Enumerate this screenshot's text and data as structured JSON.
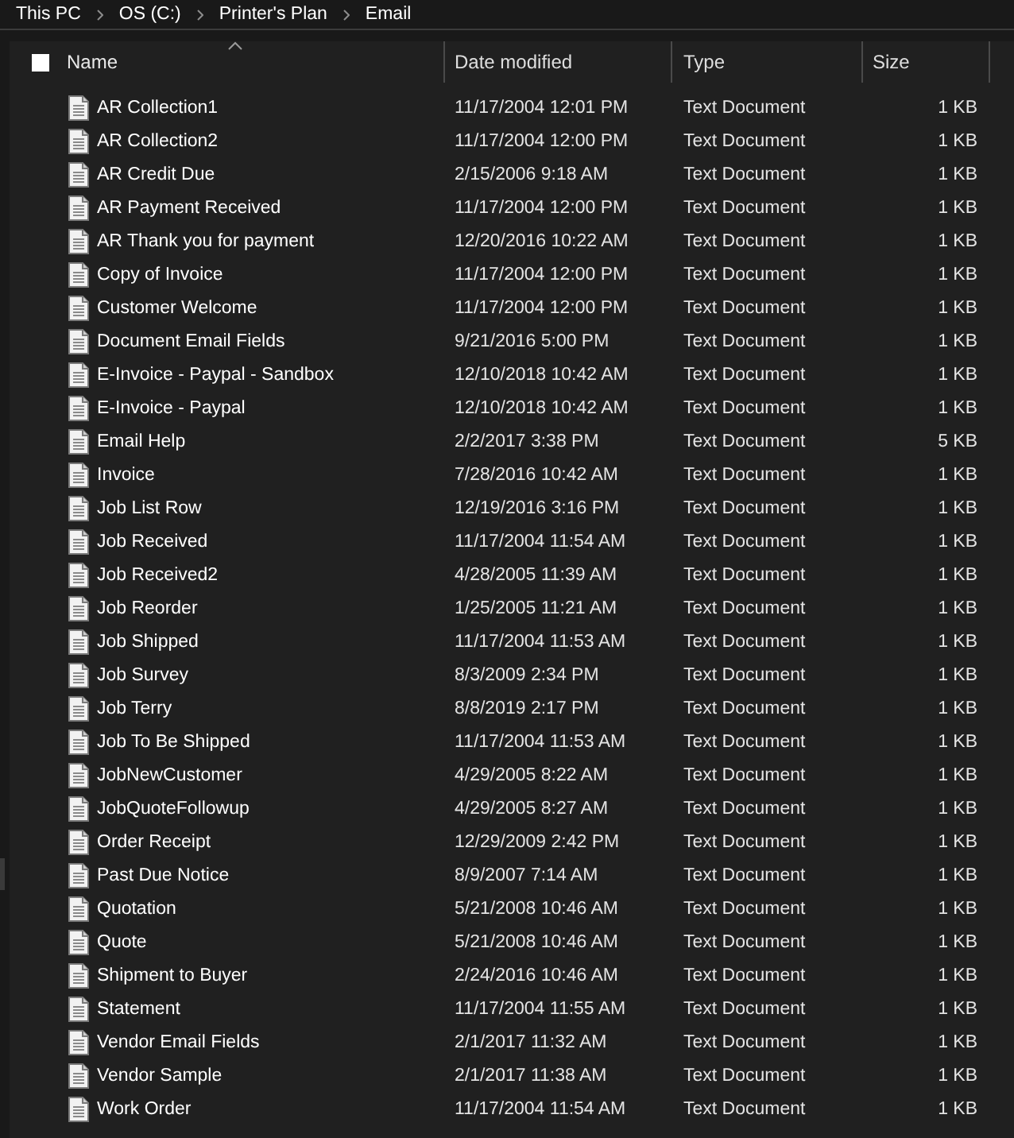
{
  "breadcrumb": [
    "This PC",
    "OS (C:)",
    "Printer's Plan",
    "Email"
  ],
  "select_all": {
    "checked": false
  },
  "columns": [
    {
      "label": "Name",
      "sorted": true
    },
    {
      "label": "Date modified",
      "sorted": false
    },
    {
      "label": "Type",
      "sorted": false
    },
    {
      "label": "Size",
      "sorted": false
    }
  ],
  "files": [
    {
      "name": "AR Collection1",
      "date_modified": "11/17/2004 12:01 PM",
      "type": "Text Document",
      "size": "1 KB"
    },
    {
      "name": "AR Collection2",
      "date_modified": "11/17/2004 12:00 PM",
      "type": "Text Document",
      "size": "1 KB"
    },
    {
      "name": "AR Credit Due",
      "date_modified": "2/15/2006 9:18 AM",
      "type": "Text Document",
      "size": "1 KB"
    },
    {
      "name": "AR Payment Received",
      "date_modified": "11/17/2004 12:00 PM",
      "type": "Text Document",
      "size": "1 KB"
    },
    {
      "name": "AR Thank you for payment",
      "date_modified": "12/20/2016 10:22 AM",
      "type": "Text Document",
      "size": "1 KB"
    },
    {
      "name": "Copy of Invoice",
      "date_modified": "11/17/2004 12:00 PM",
      "type": "Text Document",
      "size": "1 KB"
    },
    {
      "name": "Customer Welcome",
      "date_modified": "11/17/2004 12:00 PM",
      "type": "Text Document",
      "size": "1 KB"
    },
    {
      "name": "Document Email Fields",
      "date_modified": "9/21/2016 5:00 PM",
      "type": "Text Document",
      "size": "1 KB"
    },
    {
      "name": "E-Invoice - Paypal - Sandbox",
      "date_modified": "12/10/2018 10:42 AM",
      "type": "Text Document",
      "size": "1 KB"
    },
    {
      "name": "E-Invoice - Paypal",
      "date_modified": "12/10/2018 10:42 AM",
      "type": "Text Document",
      "size": "1 KB"
    },
    {
      "name": "Email Help",
      "date_modified": "2/2/2017 3:38 PM",
      "type": "Text Document",
      "size": "5 KB"
    },
    {
      "name": "Invoice",
      "date_modified": "7/28/2016 10:42 AM",
      "type": "Text Document",
      "size": "1 KB"
    },
    {
      "name": "Job List Row",
      "date_modified": "12/19/2016 3:16 PM",
      "type": "Text Document",
      "size": "1 KB"
    },
    {
      "name": "Job Received",
      "date_modified": "11/17/2004 11:54 AM",
      "type": "Text Document",
      "size": "1 KB"
    },
    {
      "name": "Job Received2",
      "date_modified": "4/28/2005 11:39 AM",
      "type": "Text Document",
      "size": "1 KB"
    },
    {
      "name": "Job Reorder",
      "date_modified": "1/25/2005 11:21 AM",
      "type": "Text Document",
      "size": "1 KB"
    },
    {
      "name": "Job Shipped",
      "date_modified": "11/17/2004 11:53 AM",
      "type": "Text Document",
      "size": "1 KB"
    },
    {
      "name": "Job Survey",
      "date_modified": "8/3/2009 2:34 PM",
      "type": "Text Document",
      "size": "1 KB"
    },
    {
      "name": "Job Terry",
      "date_modified": "8/8/2019 2:17 PM",
      "type": "Text Document",
      "size": "1 KB"
    },
    {
      "name": "Job To Be Shipped",
      "date_modified": "11/17/2004 11:53 AM",
      "type": "Text Document",
      "size": "1 KB"
    },
    {
      "name": "JobNewCustomer",
      "date_modified": "4/29/2005 8:22 AM",
      "type": "Text Document",
      "size": "1 KB"
    },
    {
      "name": "JobQuoteFollowup",
      "date_modified": "4/29/2005 8:27 AM",
      "type": "Text Document",
      "size": "1 KB"
    },
    {
      "name": "Order Receipt",
      "date_modified": "12/29/2009 2:42 PM",
      "type": "Text Document",
      "size": "1 KB"
    },
    {
      "name": "Past Due Notice",
      "date_modified": "8/9/2007 7:14 AM",
      "type": "Text Document",
      "size": "1 KB"
    },
    {
      "name": "Quotation",
      "date_modified": "5/21/2008 10:46 AM",
      "type": "Text Document",
      "size": "1 KB"
    },
    {
      "name": "Quote",
      "date_modified": "5/21/2008 10:46 AM",
      "type": "Text Document",
      "size": "1 KB"
    },
    {
      "name": "Shipment to Buyer",
      "date_modified": "2/24/2016 10:46 AM",
      "type": "Text Document",
      "size": "1 KB"
    },
    {
      "name": "Statement",
      "date_modified": "11/17/2004 11:55 AM",
      "type": "Text Document",
      "size": "1 KB"
    },
    {
      "name": "Vendor Email Fields",
      "date_modified": "2/1/2017 11:32 AM",
      "type": "Text Document",
      "size": "1 KB"
    },
    {
      "name": "Vendor Sample",
      "date_modified": "2/1/2017 11:38 AM",
      "type": "Text Document",
      "size": "1 KB"
    },
    {
      "name": "Work Order",
      "date_modified": "11/17/2004 11:54 AM",
      "type": "Text Document",
      "size": "1 KB"
    }
  ]
}
